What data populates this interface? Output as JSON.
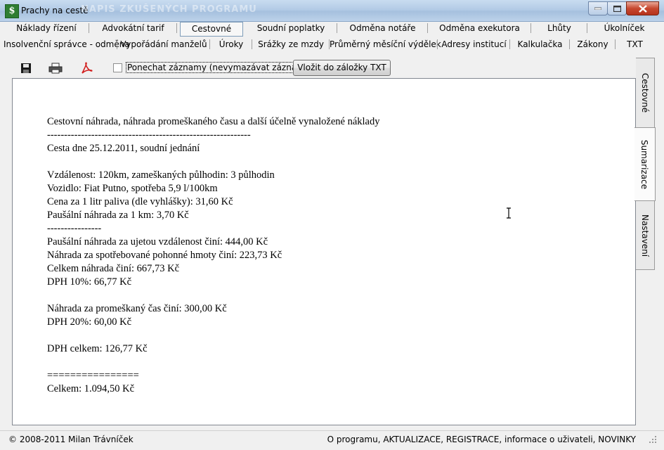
{
  "window": {
    "title": "Prachy na cestě",
    "icon_label": "$",
    "ghost_title": "NAPIS ZKUŠENÝCH PROGRAMU",
    "colors": {
      "titlebar": "#b3cbe6",
      "close": "#c7472f"
    }
  },
  "tabs_row1": [
    "Náklady řízení",
    "Advokátní tarif",
    "Cestovné",
    "Soudní poplatky",
    "Odměna notáře",
    "Odměna exekutora",
    "Lhůty",
    "Úkolníček"
  ],
  "tabs_row2": [
    "Insolvenční správce - odměna",
    "Vypořádání manželů",
    "Úroky",
    "Srážky ze mzdy",
    "Průměrný měsíční výdělek",
    "Adresy institucí",
    "Kalkulačka",
    "Zákony",
    "TXT"
  ],
  "active_tab": "Cestovné",
  "toolbar": {
    "checkbox_label": "Ponechat záznamy (nevymazávat záznamy)",
    "checkbox_checked": false,
    "insert_button": "Vložit do záložky TXT",
    "icons": [
      "save-icon",
      "print-icon",
      "pdf-icon"
    ]
  },
  "side_tabs": [
    "Cestovné",
    "Sumarizace",
    "Nastavení"
  ],
  "active_side_tab": "Sumarizace",
  "document": {
    "lines": [
      "Cestovní náhrada, náhrada promeškaného času a další účelně vynaložené náklady",
      "------------------------------------------------------------",
      "Cesta dne 25.12.2011, soudní jednání",
      "",
      "Vzdálenost: 120km, zameškaných půlhodin: 3 půlhodin",
      "Vozidlo: Fiat Putno, spotřeba 5,9 l/100km",
      "Cena za 1 litr paliva (dle vyhlášky): 31,60 Kč",
      "Paušální náhrada za 1 km: 3,70 Kč",
      "----------------",
      "Paušální náhrada za ujetou vzdálenost činí: 444,00 Kč",
      "Náhrada za spotřebované pohonné hmoty činí: 223,73 Kč",
      "Celkem náhrada činí: 667,73 Kč",
      "DPH 10%: 66,77 Kč",
      "",
      "Náhrada za promeškaný čas činí: 300,00 Kč",
      "DPH 20%: 60,00 Kč",
      "",
      "DPH celkem: 126,77 Kč",
      "",
      "================",
      "Celkem: 1.094,50 Kč"
    ]
  },
  "statusbar": {
    "left": "© 2008-2011 Milan Trávníček",
    "right": "O programu, AKTUALIZACE, REGISTRACE, informace o uživateli, NOVINKY"
  }
}
